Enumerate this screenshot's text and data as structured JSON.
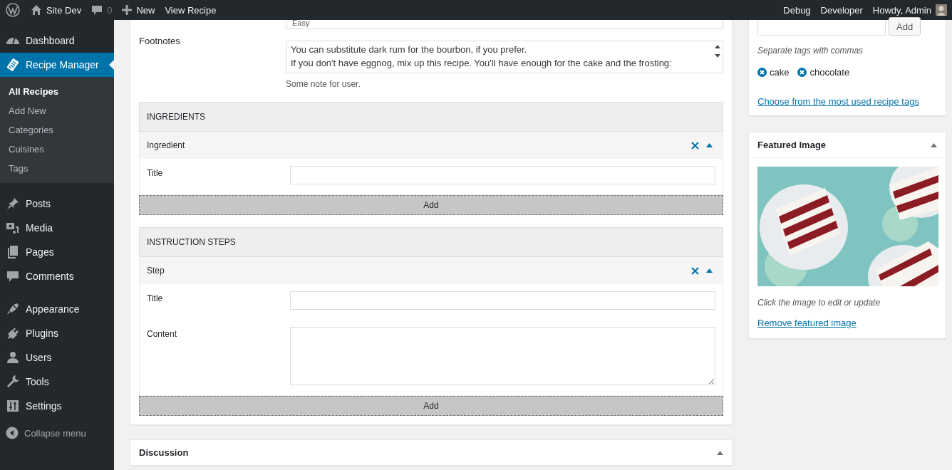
{
  "admin_bar": {
    "left": [
      {
        "kind": "logo"
      },
      {
        "kind": "site",
        "label": "Site Dev"
      },
      {
        "kind": "comments",
        "label": "0"
      },
      {
        "kind": "new",
        "label": "New"
      },
      {
        "kind": "text",
        "label": "View Recipe"
      }
    ],
    "right": [
      {
        "kind": "text",
        "label": "Debug"
      },
      {
        "kind": "text",
        "label": "Developer"
      },
      {
        "kind": "account",
        "label": "Howdy, Admin"
      }
    ]
  },
  "sidebar": {
    "groups": [
      [
        {
          "label": "Dashboard",
          "selected": false
        },
        {
          "label": "Recipe Manager",
          "selected": true,
          "children": [
            {
              "label": "All Recipes",
              "selected": true
            },
            {
              "label": "Add New",
              "selected": false
            },
            {
              "label": "Categories",
              "selected": false
            },
            {
              "label": "Cuisines",
              "selected": false
            },
            {
              "label": "Tags",
              "selected": false
            }
          ]
        }
      ],
      [
        {
          "label": "Posts",
          "selected": false
        },
        {
          "label": "Media",
          "selected": false
        },
        {
          "label": "Pages",
          "selected": false
        },
        {
          "label": "Comments",
          "selected": false
        }
      ],
      [
        {
          "label": "Appearance",
          "selected": false
        },
        {
          "label": "Plugins",
          "selected": false
        },
        {
          "label": "Users",
          "selected": false
        },
        {
          "label": "Tools",
          "selected": false
        },
        {
          "label": "Settings",
          "selected": false
        }
      ]
    ],
    "collapse_label": "Collapse menu"
  },
  "editor": {
    "top_field_value": "Easy",
    "footnotes": {
      "label": "Footnotes",
      "value": "You can substitute dark rum for the bourbon, if you prefer.\nIf you don't have eggnog, mix up this recipe. You'll have enough for the cake and the frosting:",
      "note": "Some note for user."
    },
    "repeaters": [
      {
        "title": "INGREDIENTS",
        "item_title": "Ingredient",
        "fields": [
          {
            "kind": "input",
            "label": "Title"
          }
        ],
        "add_label": "Add"
      },
      {
        "title": "INSTRUCTION STEPS",
        "item_title": "Step",
        "fields": [
          {
            "kind": "input",
            "label": "Title"
          },
          {
            "kind": "textarea",
            "label": "Content"
          }
        ],
        "add_label": "Add"
      }
    ]
  },
  "discussion": {
    "title": "Discussion"
  },
  "tags_box": {
    "add_label": "Add",
    "hint": "Separate tags with commas",
    "tags": [
      "cake",
      "chocolate"
    ],
    "link": "Choose from the most used recipe tags"
  },
  "featured_image": {
    "title": "Featured Image",
    "hint": "Click the image to edit or update",
    "link": "Remove featured image"
  }
}
